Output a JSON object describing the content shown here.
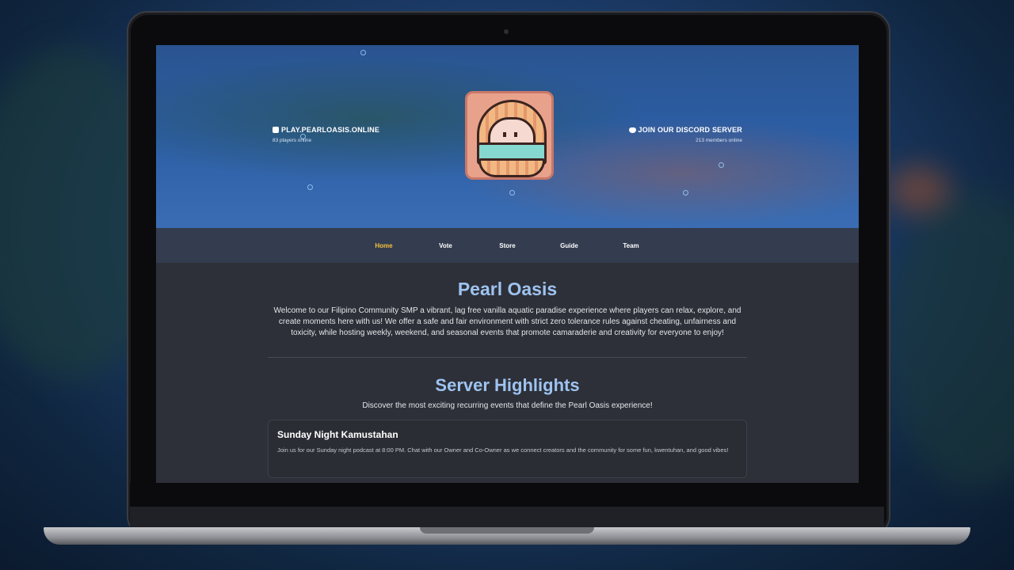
{
  "server": {
    "address": "PLAY.PEARLOASIS.ONLINE",
    "players_online": "83 players online"
  },
  "discord": {
    "label": "JOIN OUR DISCORD SERVER",
    "members_online": "213 members online"
  },
  "nav": {
    "items": [
      {
        "label": "Home",
        "active": true
      },
      {
        "label": "Vote"
      },
      {
        "label": "Store"
      },
      {
        "label": "Guide"
      },
      {
        "label": "Team"
      }
    ]
  },
  "intro": {
    "title": "Pearl Oasis",
    "text": "Welcome to our Filipino Community SMP a vibrant, lag free vanilla aquatic paradise experience where players can relax, explore, and create moments here with us! We offer a safe and fair environment with strict zero tolerance rules against cheating, unfairness and toxicity, while hosting weekly, weekend, and seasonal events that promote camaraderie and creativity for everyone to enjoy!"
  },
  "highlights": {
    "title": "Server Highlights",
    "subtitle": "Discover the most exciting recurring events that define the Pearl Oasis experience!",
    "events": [
      {
        "title": "Sunday Night Kamustahan",
        "description": "Join us for our Sunday night podcast at 8:00 PM. Chat with our Owner and Co-Owner as we connect creators and the community for some fun, kwentuhan, and good vibes!"
      }
    ]
  },
  "colors": {
    "accent": "#9ec3f0",
    "active_nav": "#f5c23a",
    "content_bg": "#2d3038"
  }
}
